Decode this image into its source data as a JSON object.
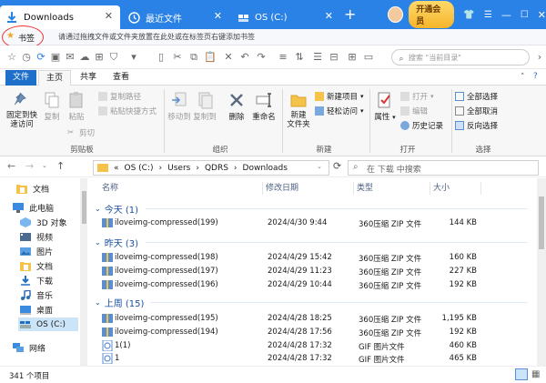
{
  "tabs": [
    {
      "label": "Downloads",
      "icon": "download-icon",
      "active": true
    },
    {
      "label": "最近文件",
      "icon": "recent-files-icon",
      "active": false
    },
    {
      "label": "OS (C:)",
      "icon": "drive-icon",
      "active": false
    }
  ],
  "titlebar": {
    "vip_label": "开通会员"
  },
  "bookmarks": {
    "label": "书签",
    "hint": "请通过拖拽文件或文件夹放置在此处或在标签页右键添加书签"
  },
  "nav_search_placeholder": "搜索 \"当前目录\"",
  "ribbon_tabs": [
    "文件",
    "主页",
    "共享",
    "查看"
  ],
  "ribbon": {
    "clipboard": {
      "pin": "固定到快\n速访问",
      "copy": "复制",
      "paste": "粘贴",
      "copy_path": "复制路径",
      "paste_shortcut": "粘贴快捷方式",
      "cut": "剪切",
      "group": "剪贴板"
    },
    "organize": {
      "move_to": "移动到",
      "copy_to": "复制到",
      "delete": "删除",
      "rename": "重命名",
      "group": "组织"
    },
    "new": {
      "new_folder": "新建\n文件夹",
      "new_item": "新建项目",
      "easy_access": "轻松访问",
      "group": "新建"
    },
    "open": {
      "properties": "属性",
      "open": "打开",
      "edit": "编辑",
      "history": "历史记录",
      "group": "打开"
    },
    "select": {
      "select_all": "全部选择",
      "select_none": "全部取消",
      "invert": "反向选择",
      "group": "选择"
    }
  },
  "address": {
    "path": [
      "OS (C:)",
      "Users",
      "QDRS",
      "Downloads"
    ],
    "search_placeholder": "在 下载 中搜索"
  },
  "sidebar": [
    {
      "label": "文档",
      "icon": "document-folder-icon"
    },
    {
      "label": "此电脑",
      "icon": "this-pc-icon"
    },
    {
      "label": "3D 对象",
      "icon": "3d-objects-icon"
    },
    {
      "label": "视频",
      "icon": "video-folder-icon"
    },
    {
      "label": "图片",
      "icon": "pictures-folder-icon"
    },
    {
      "label": "文档",
      "icon": "document-folder-icon"
    },
    {
      "label": "下载",
      "icon": "download-folder-icon"
    },
    {
      "label": "音乐",
      "icon": "music-folder-icon"
    },
    {
      "label": "桌面",
      "icon": "desktop-folder-icon"
    },
    {
      "label": "OS (C:)",
      "icon": "drive-icon",
      "selected": true
    },
    {
      "label": "网络",
      "icon": "network-icon"
    }
  ],
  "columns": [
    "名称",
    "修改日期",
    "类型",
    "大小"
  ],
  "groups": [
    {
      "label": "今天 (1)",
      "rows": [
        {
          "name": "iloveimg-compressed(199)",
          "date": "2024/4/30 9:44",
          "type": "360压缩 ZIP 文件",
          "size": "144 KB",
          "icon": "zip-file-icon"
        }
      ]
    },
    {
      "label": "昨天 (3)",
      "rows": [
        {
          "name": "iloveimg-compressed(198)",
          "date": "2024/4/29 15:42",
          "type": "360压缩 ZIP 文件",
          "size": "160 KB",
          "icon": "zip-file-icon"
        },
        {
          "name": "iloveimg-compressed(197)",
          "date": "2024/4/29 11:23",
          "type": "360压缩 ZIP 文件",
          "size": "227 KB",
          "icon": "zip-file-icon"
        },
        {
          "name": "iloveimg-compressed(196)",
          "date": "2024/4/29 10:44",
          "type": "360压缩 ZIP 文件",
          "size": "192 KB",
          "icon": "zip-file-icon"
        }
      ]
    },
    {
      "label": "上周 (15)",
      "rows": [
        {
          "name": "iloveimg-compressed(195)",
          "date": "2024/4/28 18:25",
          "type": "360压缩 ZIP 文件",
          "size": "1,195 KB",
          "icon": "zip-file-icon"
        },
        {
          "name": "iloveimg-compressed(194)",
          "date": "2024/4/28 17:56",
          "type": "360压缩 ZIP 文件",
          "size": "192 KB",
          "icon": "zip-file-icon"
        },
        {
          "name": "1(1)",
          "date": "2024/4/28 17:32",
          "type": "GIF 图片文件",
          "size": "460 KB",
          "icon": "gif-file-icon"
        },
        {
          "name": "1",
          "date": "2024/4/28 17:32",
          "type": "GIF 图片文件",
          "size": "465 KB",
          "icon": "gif-file-icon"
        }
      ]
    }
  ],
  "status": {
    "count": "341 个项目"
  },
  "colors": {
    "accent": "#2b82e6",
    "file_tab": "#1e6fc9",
    "group_text": "#1a4fa0",
    "selected_bg": "#cce4f7",
    "bookmark_circle": "#e33"
  }
}
